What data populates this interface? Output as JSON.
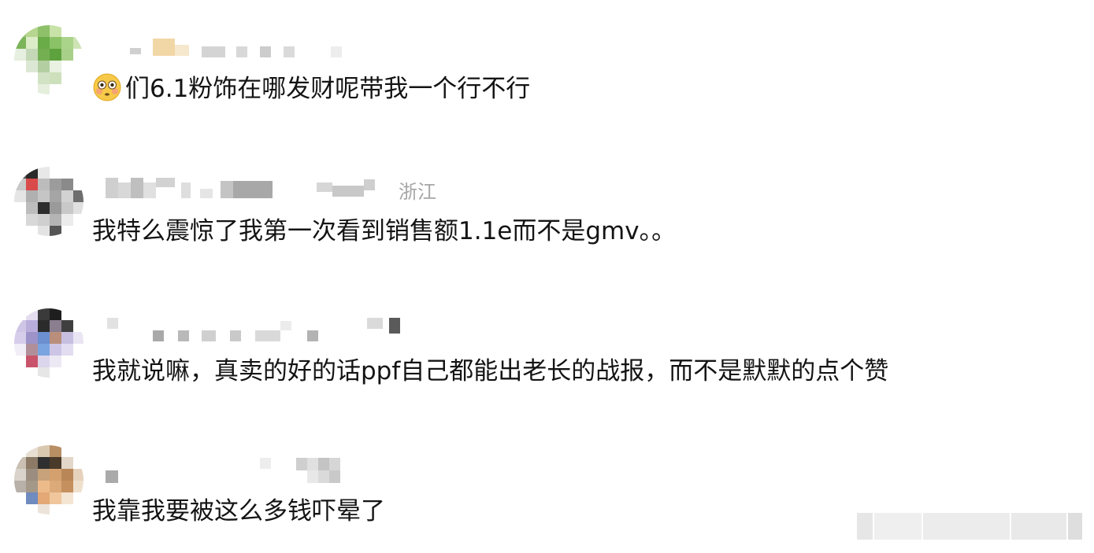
{
  "comments": [
    {
      "location": "",
      "text": "们6.1粉饰在哪发财呢带我一个行不行",
      "leading_emoji": "flushed-face-emoji"
    },
    {
      "location": "浙江",
      "text": "我特么震惊了我第一次看到销售额1.1e而不是gmv。。"
    },
    {
      "location": "",
      "text": "我就说嘛，真卖的好的话ppf自己都能出老长的战报，而不是默默的点个赞"
    },
    {
      "location": "",
      "text": "我靠我要被这么多钱吓晕了"
    }
  ],
  "colors": {
    "text": "#141414",
    "location": "#a6a6a6",
    "background": "#ffffff"
  }
}
